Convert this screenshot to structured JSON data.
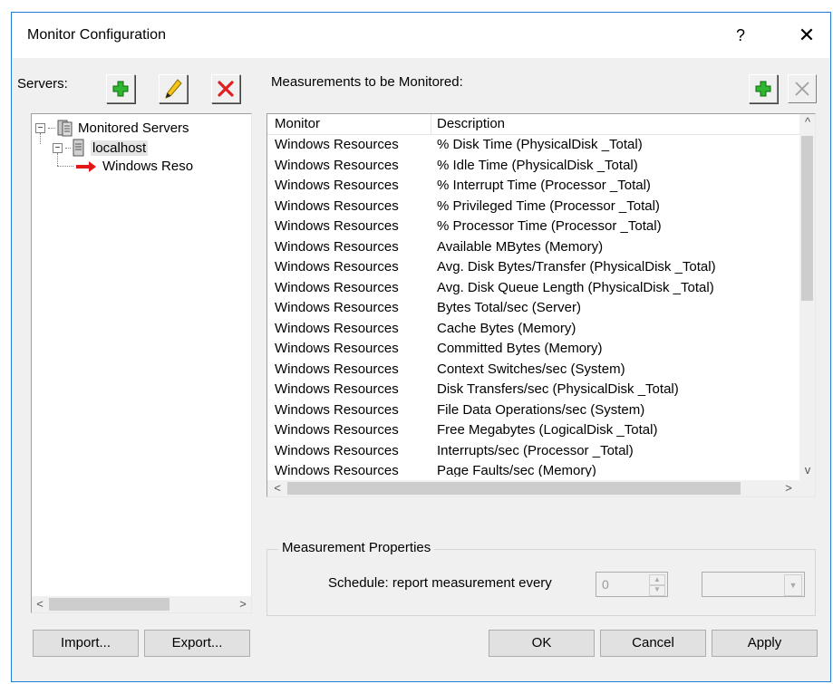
{
  "window": {
    "title": "Monitor Configuration",
    "help": "?",
    "close": "✕"
  },
  "servers": {
    "label": "Servers:",
    "add_icon": "green-plus-icon",
    "edit_icon": "pencil-icon",
    "delete_icon": "red-x-icon",
    "tree": {
      "root": "Monitored Servers",
      "host": "localhost",
      "measurement": "Windows Reso"
    }
  },
  "measurements": {
    "label": "Measurements to be Monitored:",
    "columns": [
      "Monitor",
      "Description"
    ],
    "rows": [
      [
        "Windows Resources",
        "% Disk Time (PhysicalDisk _Total)"
      ],
      [
        "Windows Resources",
        "% Idle Time (PhysicalDisk _Total)"
      ],
      [
        "Windows Resources",
        "% Interrupt Time (Processor _Total)"
      ],
      [
        "Windows Resources",
        "% Privileged Time (Processor _Total)"
      ],
      [
        "Windows Resources",
        "% Processor Time (Processor _Total)"
      ],
      [
        "Windows Resources",
        "Available MBytes (Memory)"
      ],
      [
        "Windows Resources",
        "Avg. Disk Bytes/Transfer (PhysicalDisk _Total)"
      ],
      [
        "Windows Resources",
        "Avg. Disk Queue Length (PhysicalDisk _Total)"
      ],
      [
        "Windows Resources",
        "Bytes Total/sec (Server)"
      ],
      [
        "Windows Resources",
        "Cache Bytes (Memory)"
      ],
      [
        "Windows Resources",
        "Committed Bytes (Memory)"
      ],
      [
        "Windows Resources",
        "Context Switches/sec (System)"
      ],
      [
        "Windows Resources",
        "Disk Transfers/sec (PhysicalDisk _Total)"
      ],
      [
        "Windows Resources",
        "File Data Operations/sec (System)"
      ],
      [
        "Windows Resources",
        "Free Megabytes (LogicalDisk _Total)"
      ],
      [
        "Windows Resources",
        "Interrupts/sec (Processor _Total)"
      ],
      [
        "Windows Resources",
        "Page Faults/sec (Memory)"
      ]
    ]
  },
  "properties": {
    "group_title": "Measurement Properties",
    "schedule_label": "Schedule: report measurement every",
    "schedule_value": "0",
    "unit_value": ""
  },
  "buttons": {
    "import": "Import...",
    "export": "Export...",
    "ok": "OK",
    "cancel": "Cancel",
    "apply": "Apply"
  },
  "colors": {
    "accent_border": "#1d7fd6",
    "add_green": "#1fa51f",
    "delete_red": "#e02020"
  }
}
